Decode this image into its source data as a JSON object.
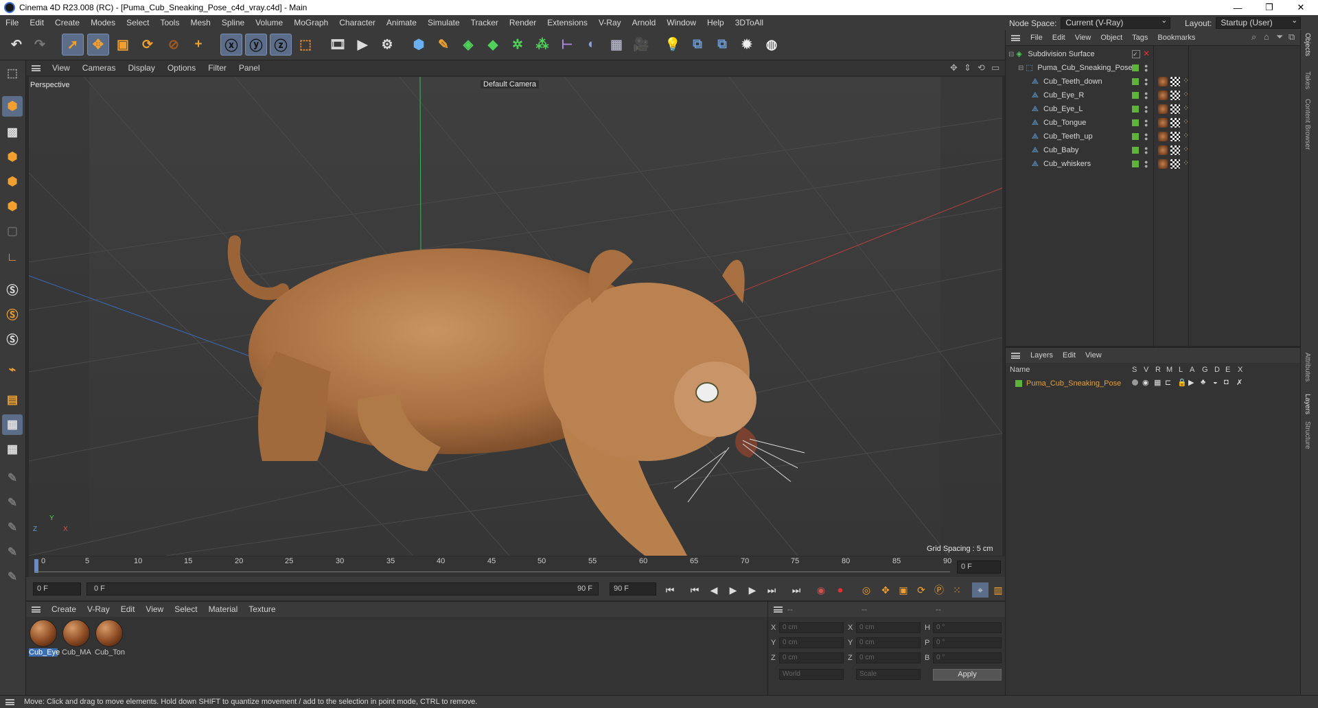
{
  "window": {
    "title": "Cinema 4D R23.008 (RC) - [Puma_Cub_Sneaking_Pose_c4d_vray.c4d] - Main",
    "minimize": "—",
    "maximize": "❐",
    "close": "✕"
  },
  "menubar": {
    "items": [
      "File",
      "Edit",
      "Create",
      "Modes",
      "Select",
      "Tools",
      "Mesh",
      "Spline",
      "Volume",
      "MoGraph",
      "Character",
      "Animate",
      "Simulate",
      "Tracker",
      "Render",
      "Extensions",
      "V-Ray",
      "Arnold",
      "Window",
      "Help",
      "3DToAll"
    ],
    "node_space_label": "Node Space:",
    "node_space_value": "Current (V-Ray)",
    "layout_label": "Layout:",
    "layout_value": "Startup (User)"
  },
  "viewport": {
    "menu": [
      "View",
      "Cameras",
      "Display",
      "Options",
      "Filter",
      "Panel"
    ],
    "view_name": "Perspective",
    "camera": "Default Camera",
    "grid_spacing": "Grid Spacing : 5 cm",
    "axis_x": "X",
    "axis_y": "Y",
    "axis_z": "Z"
  },
  "timeline": {
    "ticks": [
      "0",
      "5",
      "10",
      "15",
      "20",
      "25",
      "30",
      "35",
      "40",
      "45",
      "50",
      "55",
      "60",
      "65",
      "70",
      "75",
      "80",
      "85",
      "90"
    ],
    "current_frame": "0 F"
  },
  "transport": {
    "start_field": "0 F",
    "range_start": "0 F",
    "range_end": "90 F",
    "end_field": "90 F"
  },
  "materials": {
    "menu": [
      "Create",
      "V-Ray",
      "Edit",
      "View",
      "Select",
      "Material",
      "Texture"
    ],
    "items": [
      {
        "label": "Cub_Eye"
      },
      {
        "label": "Cub_MA"
      },
      {
        "label": "Cub_Ton"
      }
    ]
  },
  "coordinates": {
    "header": [
      "--",
      "--",
      "--"
    ],
    "rows": [
      {
        "a": "X",
        "av": "0 cm",
        "b": "X",
        "bv": "0 cm",
        "c": "H",
        "cv": "0 °"
      },
      {
        "a": "Y",
        "av": "0 cm",
        "b": "Y",
        "bv": "0 cm",
        "c": "P",
        "cv": "0 °"
      },
      {
        "a": "Z",
        "av": "0 cm",
        "b": "Z",
        "bv": "0 cm",
        "c": "B",
        "cv": "0 °"
      }
    ],
    "mode": "World",
    "scale": "Scale",
    "apply": "Apply"
  },
  "objects": {
    "menu": [
      "File",
      "Edit",
      "View",
      "Object",
      "Tags",
      "Bookmarks"
    ],
    "tree": [
      {
        "name": "Subdivision Surface",
        "level": 0
      },
      {
        "name": "Puma_Cub_Sneaking_Pose",
        "level": 1
      },
      {
        "name": "Cub_Teeth_down",
        "level": 2
      },
      {
        "name": "Cub_Eye_R",
        "level": 2
      },
      {
        "name": "Cub_Eye_L",
        "level": 2
      },
      {
        "name": "Cub_Tongue",
        "level": 2
      },
      {
        "name": "Cub_Teeth_up",
        "level": 2
      },
      {
        "name": "Cub_Baby",
        "level": 2
      },
      {
        "name": "Cub_whiskers",
        "level": 2
      }
    ]
  },
  "layers": {
    "menu": [
      "Layers",
      "Edit",
      "View"
    ],
    "col_name": "Name",
    "cols": [
      "S",
      "V",
      "R",
      "M",
      "L",
      "A",
      "G",
      "D",
      "E",
      "X"
    ],
    "items": [
      {
        "name": "Puma_Cub_Sneaking_Pose"
      }
    ]
  },
  "right_tabs": [
    "Objects",
    "Takes",
    "Content Browser",
    "Attributes",
    "Layers",
    "Structure"
  ],
  "status": {
    "text": "Move: Click and drag to move elements. Hold down SHIFT to quantize movement / add to the selection in point mode, CTRL to remove."
  },
  "colors": {
    "accent": "#5c6d8a",
    "layer_green": "#5fb33b",
    "layer_name": "#e0a040"
  }
}
